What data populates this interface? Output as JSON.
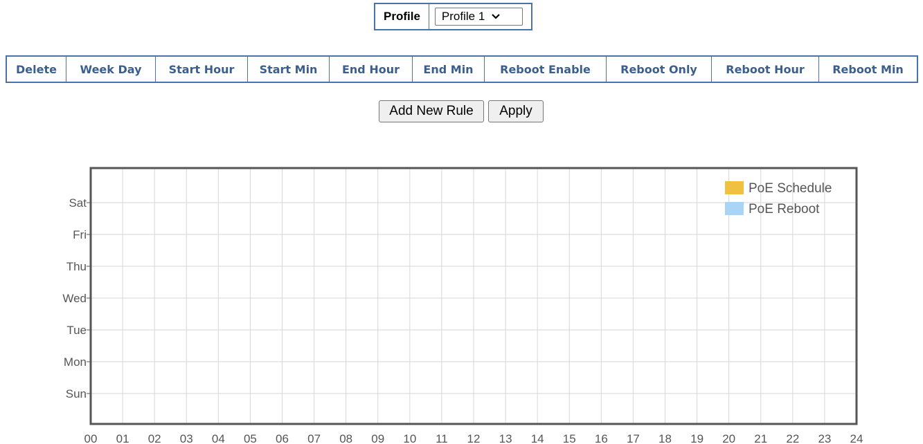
{
  "profile": {
    "label": "Profile",
    "selected": "Profile 1"
  },
  "rules_table": {
    "headers": [
      "Delete",
      "Week Day",
      "Start Hour",
      "Start Min",
      "End Hour",
      "End Min",
      "Reboot Enable",
      "Reboot Only",
      "Reboot Hour",
      "Reboot Min"
    ],
    "rows": []
  },
  "buttons": {
    "add_new_rule": "Add New Rule",
    "apply": "Apply"
  },
  "chart_data": {
    "type": "bar",
    "x": [
      "00",
      "01",
      "02",
      "03",
      "04",
      "05",
      "06",
      "07",
      "08",
      "09",
      "10",
      "11",
      "12",
      "13",
      "14",
      "15",
      "16",
      "17",
      "18",
      "19",
      "20",
      "21",
      "22",
      "23",
      "24"
    ],
    "xlim": [
      0,
      24
    ],
    "categories": [
      "Sun",
      "Mon",
      "Tue",
      "Wed",
      "Thu",
      "Fri",
      "Sat"
    ],
    "series": [
      {
        "name": "PoE Schedule",
        "color": "#f0c040",
        "values": []
      },
      {
        "name": "PoE Reboot",
        "color": "#aad4f5",
        "values": []
      }
    ],
    "grid": true,
    "legend": "top-right",
    "title": "",
    "xlabel": "",
    "ylabel": ""
  }
}
